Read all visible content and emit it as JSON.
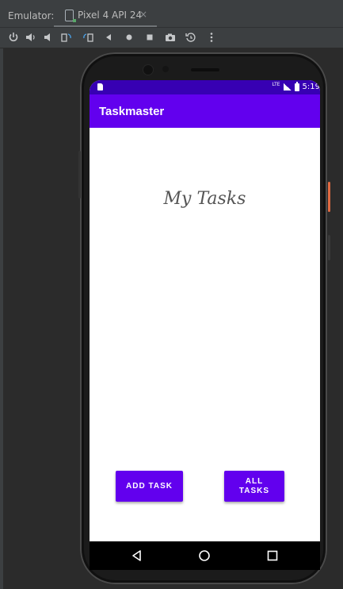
{
  "emulator": {
    "label": "Emulator:",
    "device_tab": "Pixel 4 API 24",
    "close_glyph": "×",
    "toolbar_icons": [
      "power-icon",
      "volume-up-icon",
      "volume-down-icon",
      "rotate-left-icon",
      "rotate-right-icon",
      "back-icon",
      "home-icon",
      "overview-icon",
      "screenshot-icon",
      "snapshot-icon",
      "more-icon"
    ],
    "accent_side_button": "#e06a42"
  },
  "phone": {
    "status_bar": {
      "network": "LTE",
      "time": "5:19",
      "color": "#3700b3"
    },
    "app_bar": {
      "title": "Taskmaster",
      "color": "#6200ee"
    },
    "main": {
      "heading": "My Tasks",
      "add_task_label": "ADD TASK",
      "all_tasks_label": "ALL TASKS"
    },
    "nav_bar": {
      "icons": [
        "back-triangle-icon",
        "home-circle-icon",
        "recents-square-icon"
      ]
    }
  }
}
